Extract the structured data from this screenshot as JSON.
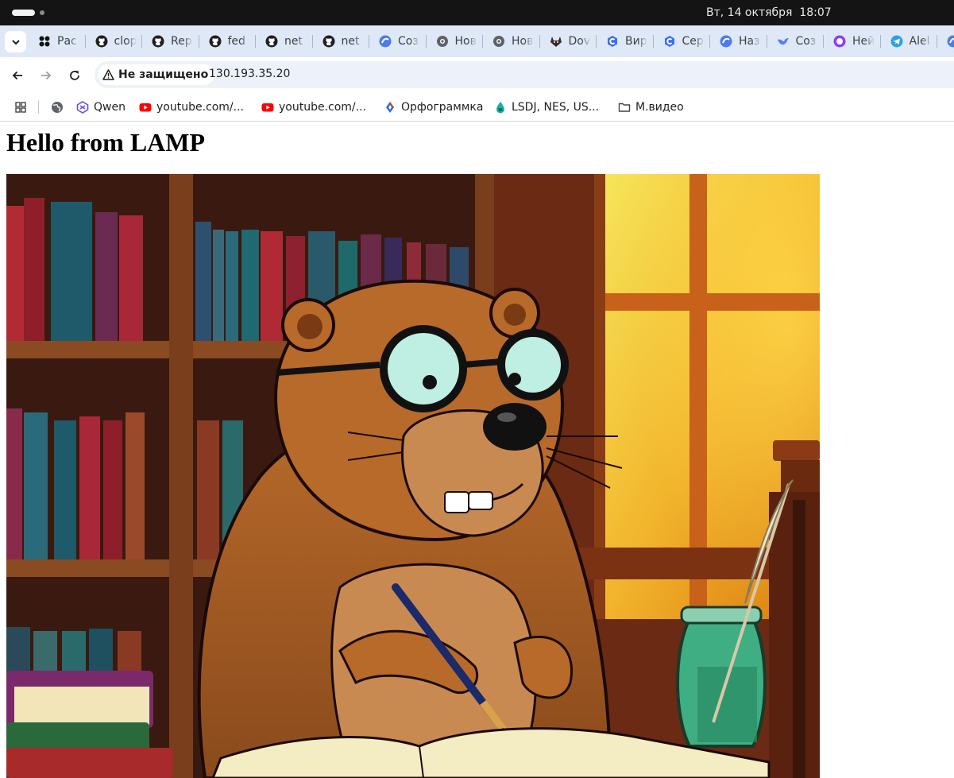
{
  "system": {
    "clock": "Вт, 14 октября  18:07"
  },
  "tabs": [
    {
      "label": "Рас",
      "icon": "pinwheel-icon"
    },
    {
      "label": "clop",
      "icon": "github-icon"
    },
    {
      "label": "Rep",
      "icon": "github-icon"
    },
    {
      "label": "fed",
      "icon": "github-icon"
    },
    {
      "label": "net",
      "icon": "github-icon"
    },
    {
      "label": "net",
      "icon": "github-icon"
    },
    {
      "label": "Соз",
      "icon": "blue-swirl-icon"
    },
    {
      "label": "Нов",
      "icon": "globe-dark-icon"
    },
    {
      "label": "Нов",
      "icon": "globe-dark-icon"
    },
    {
      "label": "Dov",
      "icon": "gitlab-icon"
    },
    {
      "label": "Вир",
      "icon": "c-logo-icon"
    },
    {
      "label": "Сер",
      "icon": "c-logo-icon"
    },
    {
      "label": "Наз",
      "icon": "blue-swirl-icon"
    },
    {
      "label": "Соз",
      "icon": "bird-icon"
    },
    {
      "label": "Ней",
      "icon": "purple-circle-icon"
    },
    {
      "label": "Alel",
      "icon": "telegram-icon"
    },
    {
      "label": "",
      "icon": "blue-swirl-icon"
    }
  ],
  "toolbar": {
    "security_label": "Не защищено",
    "url": "130.193.35.20"
  },
  "bookmarks": [
    {
      "label": "",
      "icon": "globe-icon"
    },
    {
      "label": "Qwen",
      "icon": "qwen-icon"
    },
    {
      "label": "youtube.com/...",
      "icon": "youtube-icon"
    },
    {
      "label": "youtube.com/...",
      "icon": "youtube-icon"
    },
    {
      "label": "Орфограммка",
      "icon": "orfogrammka-icon"
    },
    {
      "label": "LSDJ, NES, US...",
      "icon": "drop-icon"
    },
    {
      "label": "М.видео",
      "icon": "folder-icon"
    }
  ],
  "page": {
    "heading": "Hello from LAMP",
    "image_description": "cartoon-beaver-writing-in-library"
  },
  "colors": {
    "sysbar": "#141414",
    "tabstrip": "#dfe8f7",
    "omnibox": "#edf2fa"
  }
}
